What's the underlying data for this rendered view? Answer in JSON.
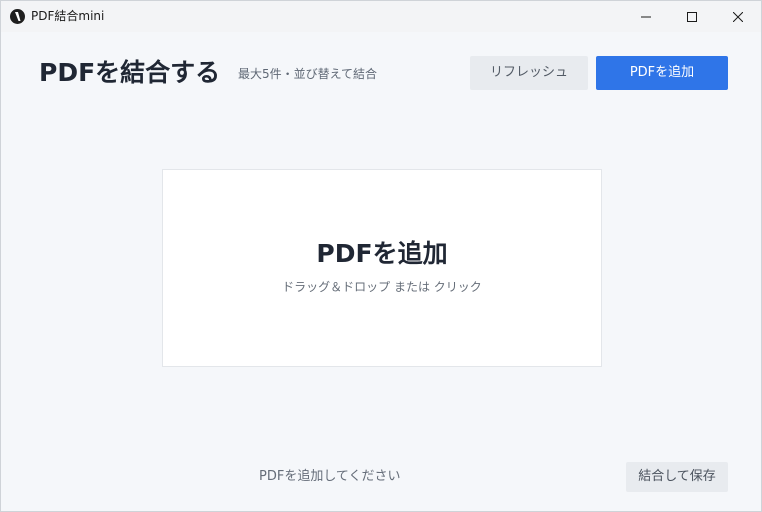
{
  "window": {
    "title": "PDF結合mini"
  },
  "header": {
    "title": "PDFを結合する",
    "subtitle": "最大5件・並び替えて結合",
    "refresh_label": "リフレッシュ",
    "add_pdf_label": "PDFを追加"
  },
  "dropzone": {
    "title": "PDFを追加",
    "hint": "ドラッグ＆ドロップ または クリック"
  },
  "footer": {
    "status": "PDFを追加してください",
    "merge_save_label": "結合して保存"
  },
  "colors": {
    "accent": "#2f75e8",
    "background": "#f5f7fa",
    "secondary_button": "#e8ebef",
    "title_text": "#202734"
  },
  "icons": {
    "app": "app-logo-icon",
    "minimize": "minimize-icon",
    "maximize": "maximize-icon",
    "close": "close-icon"
  }
}
